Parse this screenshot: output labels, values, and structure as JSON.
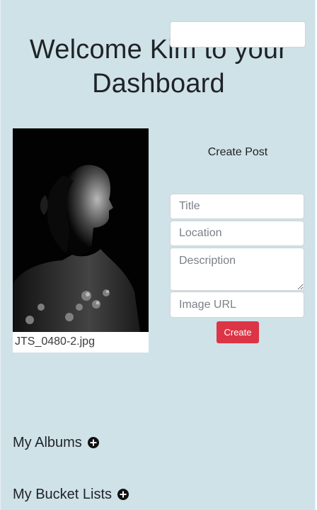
{
  "header": {
    "title_line1": "Welcome Kim to your",
    "title_line2": "Dashboard"
  },
  "photo": {
    "caption": "JTS_0480-2.jpg"
  },
  "create_post": {
    "heading": "Create Post",
    "fields": {
      "top_value": "",
      "title_placeholder": "Title",
      "location_placeholder": "Location",
      "description_placeholder": "Description",
      "image_url_placeholder": "Image URL"
    },
    "button_label": "Create"
  },
  "sections": {
    "albums_label": "My Albums",
    "bucket_lists_label": "My Bucket Lists"
  },
  "icons": {
    "albums_add": "plus-circle-icon",
    "bucket_add": "plus-circle-icon"
  },
  "colors": {
    "background": "#cfe2e8",
    "accent_button": "#dc3545"
  }
}
